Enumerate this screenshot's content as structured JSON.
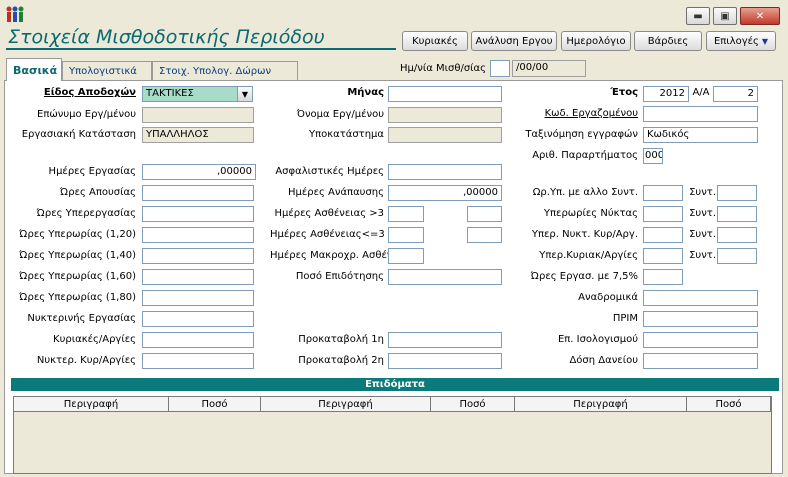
{
  "window": {
    "minimize_glyph": "▬",
    "maximize_glyph": "▣",
    "close_glyph": "✕"
  },
  "header": {
    "title": "Στοιχεία Μισθοδοτικής Περιόδου",
    "buttons": {
      "sundays": "Κυριακές",
      "work_analysis": "Ανάλυση Εργου",
      "calendar": "Ημερολόγιο",
      "shifts": "Βάρδιες",
      "options": "Επιλογές"
    }
  },
  "tabs": {
    "basic": "Βασικά",
    "computed": "Υπολογιστικά",
    "gifts": "Στοιχ. Υπολογ. Δώρων"
  },
  "payroll_date": {
    "label": "Ημ/νία Μισθ/σίας",
    "value": "",
    "date": "/00/00"
  },
  "left": {
    "earnings_type_label": "Είδος Αποδοχών",
    "earnings_type_value": "ΤΑΚΤΙΚΕΣ",
    "surname_label": "Επώνυμο Εργ/μένου",
    "surname_value": "",
    "employment_status_label": "Εργασιακή Κατάσταση",
    "employment_status_value": "ΥΠΑΛΛΗΛΟΣ",
    "work_days_label": "Ημέρες Εργασίας",
    "work_days_value": ",00000",
    "absence_hours_label": "Ώρες Απουσίας",
    "overtime_work_label": "Ώρες Υπερεργασίας",
    "overtime_120_label": "Ώρες Υπερωρίας (1,20)",
    "overtime_140_label": "Ώρες Υπερωρίας (1,40)",
    "overtime_160_label": "Ώρες Υπερωρίας (1,60)",
    "overtime_180_label": "Ώρες Υπερωρίας (1,80)",
    "night_work_label": "Νυκτερινής Εργασίας",
    "sundays_holidays_label": "Κυριακές/Αργίες",
    "night_sun_label": "Νυκτερ. Κυρ/Αργίες"
  },
  "middle": {
    "month_label": "Μήνας",
    "month_value": "",
    "employee_name_label": "Όνομα Εργ/μένου",
    "branch_label": "Υποκατάστημα",
    "insurance_days_label": "Ασφαλιστικές Ημέρες",
    "rest_days_label": "Ημέρες Ανάπαυσης",
    "rest_days_value": ",00000",
    "sick_gt3_label": "Ημέρες Ασθένειας >3",
    "sick_le3_label": "Ημέρες Ασθένειας<=3",
    "long_sick_label": "Ημέρες Μακροχρ. Ασθέν.",
    "subsidy_label": "Ποσό Επιδότησης",
    "advance1_label": "Προκαταβολή 1η",
    "advance2_label": "Προκαταβολή 2η"
  },
  "right": {
    "year_label": "Έτος",
    "year_value": "2012",
    "aa_label": "Α/Α",
    "aa_value": "2",
    "employee_code_label": "Κωδ. Εργαζομένου",
    "sort_label": "Ταξινόμηση εγγραφών",
    "sort_value": "Κωδικός",
    "branch_no_label": "Αριθ. Παραρτήματος",
    "branch_no_value": "000",
    "ot_other_label": "Ωρ.Υπ. με αλλο Συντ.",
    "night_ot_label": "Υπερωρίες Νύκτας",
    "night_ot_sun_label": "Υπερ. Νυκτ. Κυρ/Αργ.",
    "ot_sun_label": "Υπερ.Κυριακ/Αργίες",
    "coef_label": "Συντ.",
    "work_75_label": "Ώρες Εργασ. με 7,5%",
    "retroactive_label": "Αναδρομικά",
    "prim_label": "ΠΡΙΜ",
    "balance_allow_label": "Επ. Ισολογισμού",
    "loan_label": "Δόση Δανείου"
  },
  "allowances": {
    "title": "Επιδόματα",
    "columns": [
      "Περιγραφή",
      "Ποσό",
      "Περιγραφή",
      "Ποσό",
      "Περιγραφή",
      "Ποσό"
    ]
  }
}
